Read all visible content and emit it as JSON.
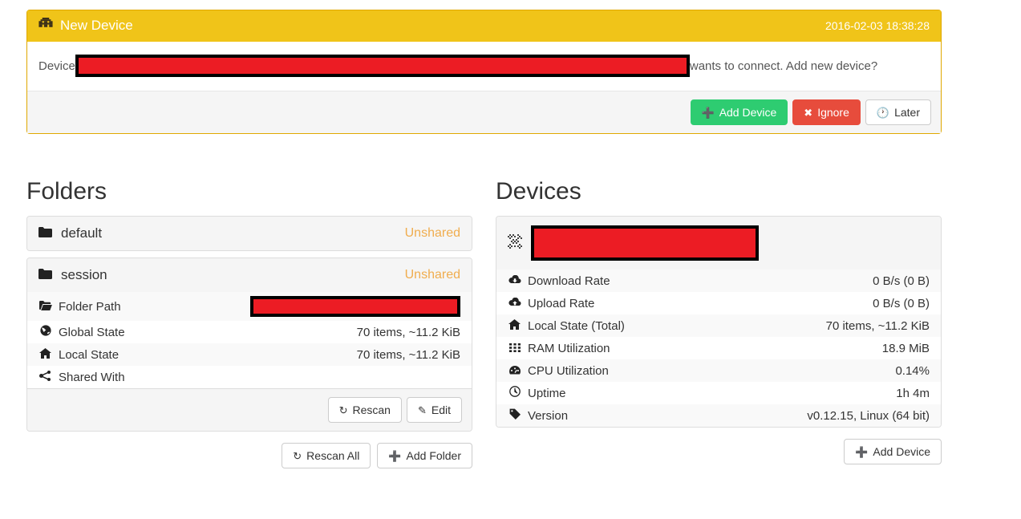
{
  "alert": {
    "icon": "device-icon",
    "title": "New Device",
    "timestamp": "2016-02-03 18:38:28",
    "body_prefix": "Device",
    "body_suffix": "wants to connect. Add new device?",
    "device_name_redacted": true,
    "buttons": [
      {
        "label": "Add Device",
        "icon": "plus-icon",
        "style": "success"
      },
      {
        "label": "Ignore",
        "icon": "times-icon",
        "style": "danger"
      },
      {
        "label": "Later",
        "icon": "clock-icon",
        "style": "default"
      }
    ],
    "colors": {
      "header_bg": "#f0c419",
      "border": "#e0a800",
      "footer_bg": "#f5f5f5"
    }
  },
  "folders": {
    "title": "Folders",
    "items": [
      {
        "name": "default",
        "icon": "folder-icon",
        "status": "Unshared"
      },
      {
        "name": "session",
        "icon": "folder-icon",
        "status": "Unshared"
      }
    ],
    "expanded_index": 1,
    "details": [
      {
        "icon": "folder-open-icon",
        "label": "Folder Path",
        "value": "",
        "redacted": true
      },
      {
        "icon": "globe-icon",
        "label": "Global State",
        "value": "70 items, ~11.2 KiB",
        "redacted": false
      },
      {
        "icon": "home-icon",
        "label": "Local State",
        "value": "70 items, ~11.2 KiB",
        "redacted": false
      },
      {
        "icon": "share-alt-icon",
        "label": "Shared With",
        "value": "",
        "redacted": false
      }
    ],
    "panel_buttons": [
      {
        "label": "Rescan",
        "icon": "refresh-icon"
      },
      {
        "label": "Edit",
        "icon": "pencil-icon"
      }
    ],
    "column_buttons": [
      {
        "label": "Rescan All",
        "icon": "refresh-icon"
      },
      {
        "label": "Add Folder",
        "icon": "plus-icon"
      }
    ],
    "status_color": "#f0ad4e"
  },
  "devices": {
    "title": "Devices",
    "header": {
      "icon": "qr-device-icon",
      "name_redacted": true,
      "name": ""
    },
    "details": [
      {
        "icon": "cloud-download-icon",
        "label": "Download Rate",
        "value": "0 B/s (0 B)"
      },
      {
        "icon": "cloud-upload-icon",
        "label": "Upload Rate",
        "value": "0 B/s (0 B)"
      },
      {
        "icon": "home-icon",
        "label": "Local State (Total)",
        "value": "70 items, ~11.2 KiB"
      },
      {
        "icon": "th-icon",
        "label": "RAM Utilization",
        "value": "18.9 MiB"
      },
      {
        "icon": "tachometer-icon",
        "label": "CPU Utilization",
        "value": "0.14%"
      },
      {
        "icon": "clock-icon",
        "label": "Uptime",
        "value": "1h 4m"
      },
      {
        "icon": "tag-icon",
        "label": "Version",
        "value": "v0.12.15, Linux (64 bit)"
      }
    ],
    "column_buttons": [
      {
        "label": "Add Device",
        "icon": "plus-icon"
      }
    ]
  }
}
